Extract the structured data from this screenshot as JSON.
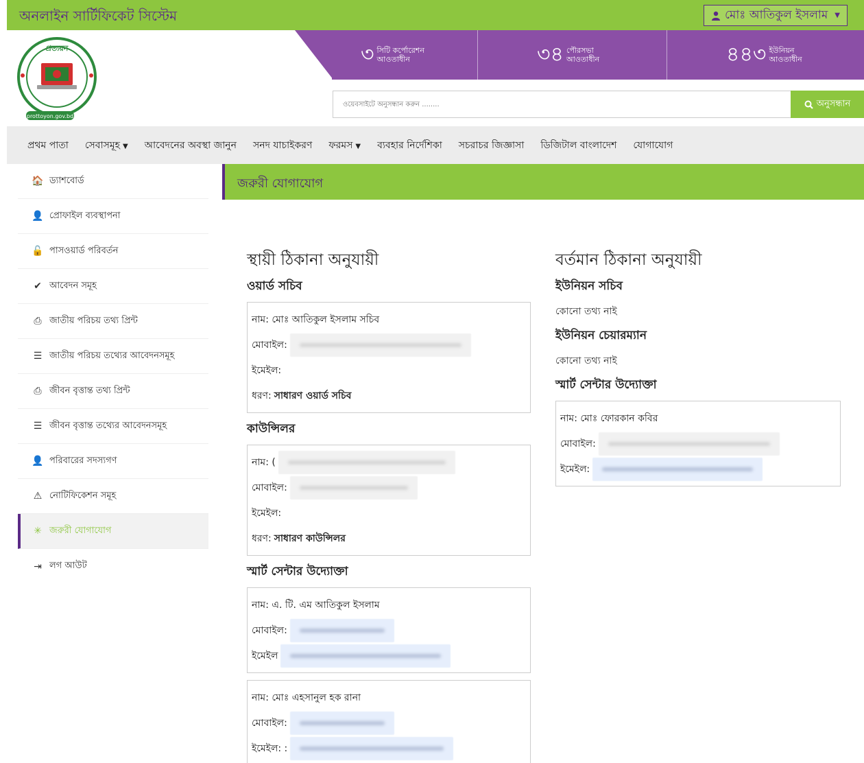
{
  "topbar": {
    "brand": "অনলাইন সার্টিফিকেট সিস্টেম",
    "user_name": "মোঃ আতিকুল ইসলাম",
    "colors": {
      "green": "#8dc63f",
      "purple": "#8b4fa6"
    }
  },
  "stats": [
    {
      "number": "৩",
      "label1": "সিটি কর্পোরেশন",
      "label2": "আওতাধীন"
    },
    {
      "number": "৩৪",
      "label1": "পৌরসভা",
      "label2": "আওতাধীন"
    },
    {
      "number": "৪৪৩",
      "label1": "ইউনিয়ন",
      "label2": "আওতাধীন"
    }
  ],
  "logo": {
    "text_top": "প্রত্যয়ন",
    "text_url": "prottoyon.gov.bd"
  },
  "search": {
    "placeholder": "ওয়েবসাইটে অনুসন্ধান করুন ........",
    "button_label": "অনুসন্ধান"
  },
  "nav": [
    {
      "label": "প্রথম পাতা",
      "dropdown": false
    },
    {
      "label": "সেবাসমূহ",
      "dropdown": true
    },
    {
      "label": "আবেদনের অবস্থা জানুন",
      "dropdown": false
    },
    {
      "label": "সনদ যাচাইকরণ",
      "dropdown": false
    },
    {
      "label": "ফরমস",
      "dropdown": true
    },
    {
      "label": "ব্যবহার নির্দেশিকা",
      "dropdown": false
    },
    {
      "label": "সচরাচর জিজ্ঞাসা",
      "dropdown": false
    },
    {
      "label": "ডিজিটাল বাংলাদেশ",
      "dropdown": false
    },
    {
      "label": "যোগাযোগ",
      "dropdown": false
    }
  ],
  "sidebar": {
    "items": [
      {
        "label": "ড্যাশবোর্ড",
        "icon": "home-icon",
        "glyph": "🏠"
      },
      {
        "label": "প্রোফাইল ব্যবস্থাপনা",
        "icon": "user-icon",
        "glyph": "👤"
      },
      {
        "label": "পাসওয়ার্ড পরিবর্তন",
        "icon": "unlock-icon",
        "glyph": "🔓"
      },
      {
        "label": "আবেদন সমূহ",
        "icon": "check-icon",
        "glyph": "✔"
      },
      {
        "label": "জাতীয় পরিচয় তথ্য প্রিন্ট",
        "icon": "print-icon",
        "glyph": "⎙"
      },
      {
        "label": "জাতীয় পরিচয় তথ্যের আবেদনসমূহ",
        "icon": "list-icon",
        "glyph": "☰"
      },
      {
        "label": "জীবন বৃত্তান্ত তথ্য প্রিন্ট",
        "icon": "print-icon",
        "glyph": "⎙"
      },
      {
        "label": "জীবন বৃত্তান্ত তথ্যের আবেদনসমূহ",
        "icon": "list-icon",
        "glyph": "☰"
      },
      {
        "label": "পরিবারের সদস্যগণ",
        "icon": "user-icon",
        "glyph": "👤"
      },
      {
        "label": "নোটিফিকেশন সমূহ",
        "icon": "warning-icon",
        "glyph": "⚠"
      },
      {
        "label": "জরুরী যোগাযোগ",
        "icon": "asterisk-icon",
        "glyph": "✳",
        "active": true
      },
      {
        "label": "লগ আউট",
        "icon": "logout-icon",
        "glyph": "⇥"
      }
    ]
  },
  "page_title": "জরুরী যোগাযোগ",
  "left": {
    "title": "স্থায়ী ঠিকানা অনুযায়ী",
    "ward_secretary": {
      "heading": "ওয়ার্ড সচিব",
      "name_row": "নাম: মোঃ আতিকুল ইসলাম সচিব",
      "mobile_label": "মোবাইল:",
      "email_label": "ইমেইল:",
      "type_label": "ধরণ:",
      "type_value": "সাধারণ ওয়ার্ড সচিব"
    },
    "councillor": {
      "heading": "কাউন্সিলর",
      "name_label": "নাম: (",
      "mobile_label": "মোবাইল:",
      "email_label": "ইমেইল:",
      "type_label": "ধরণ:",
      "type_value": "সাধারণ কাউন্সিলর"
    },
    "smart_center": {
      "heading": "স্মার্ট সেন্টার উদ্যোক্তা",
      "entries": [
        {
          "name_row": "নাম: এ. টি. এম আতিকুল ইসলাম",
          "mobile_label": "মোবাইল:",
          "email_label": "ইমেইল"
        },
        {
          "name_row": "নাম: মোঃ এহসানুল হক রানা",
          "mobile_label": "মোবাইল:",
          "email_label": "ইমেইল: :"
        }
      ]
    }
  },
  "right": {
    "title": "বর্তমান ঠিকানা অনুযায়ী",
    "union_secretary": {
      "heading": "ইউনিয়ন সচিব",
      "info": "কোনো তথ্য নাই"
    },
    "union_chairman": {
      "heading": "ইউনিয়ন চেয়ারম্যান",
      "info": "কোনো তথ্য নাই"
    },
    "smart_center": {
      "heading": "স্মার্ট সেন্টার উদ্যোক্তা",
      "name_row": "নাম: মোঃ ফোরকান কবির",
      "mobile_label": "মোবাইল:",
      "email_label": "ইমেইল:"
    }
  }
}
